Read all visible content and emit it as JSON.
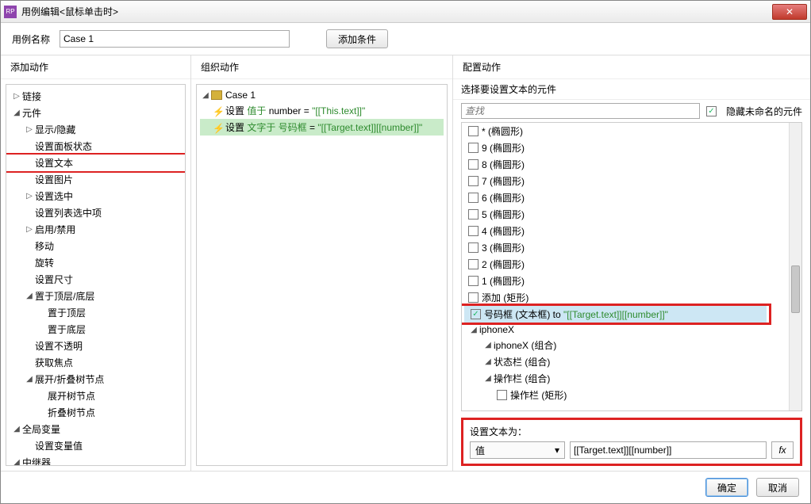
{
  "titlebar": {
    "title": "用例编辑<鼠标单击时>",
    "appicon": "RP"
  },
  "topbar": {
    "name_label": "用例名称",
    "name_value": "Case 1",
    "add_condition": "添加条件"
  },
  "columns": {
    "add_action": "添加动作",
    "org_action": "组织动作",
    "cfg_action": "配置动作"
  },
  "actions_tree": [
    {
      "level": 0,
      "caret": "▷",
      "label": "链接"
    },
    {
      "level": 0,
      "caret": "◢",
      "label": "元件"
    },
    {
      "level": 1,
      "caret": "▷",
      "label": "显示/隐藏"
    },
    {
      "level": 1,
      "caret": "",
      "label": "设置面板状态"
    },
    {
      "level": 1,
      "caret": "",
      "label": "设置文本",
      "red": true
    },
    {
      "level": 1,
      "caret": "",
      "label": "设置图片"
    },
    {
      "level": 1,
      "caret": "▷",
      "label": "设置选中"
    },
    {
      "level": 1,
      "caret": "",
      "label": "设置列表选中项"
    },
    {
      "level": 1,
      "caret": "▷",
      "label": "启用/禁用"
    },
    {
      "level": 1,
      "caret": "",
      "label": "移动"
    },
    {
      "level": 1,
      "caret": "",
      "label": "旋转"
    },
    {
      "level": 1,
      "caret": "",
      "label": "设置尺寸"
    },
    {
      "level": 1,
      "caret": "◢",
      "label": "置于顶层/底层"
    },
    {
      "level": 2,
      "caret": "",
      "label": "置于顶层"
    },
    {
      "level": 2,
      "caret": "",
      "label": "置于底层"
    },
    {
      "level": 1,
      "caret": "",
      "label": "设置不透明"
    },
    {
      "level": 1,
      "caret": "",
      "label": "获取焦点"
    },
    {
      "level": 1,
      "caret": "◢",
      "label": "展开/折叠树节点"
    },
    {
      "level": 2,
      "caret": "",
      "label": "展开树节点"
    },
    {
      "level": 2,
      "caret": "",
      "label": "折叠树节点"
    },
    {
      "level": 0,
      "caret": "◢",
      "label": "全局变量"
    },
    {
      "level": 1,
      "caret": "",
      "label": "设置变量值"
    },
    {
      "level": 0,
      "caret": "◢",
      "label": "中继器"
    }
  ],
  "case": {
    "name": "Case 1",
    "rows": [
      {
        "prefix": "设置 ",
        "green": "值于",
        "mid": " number = ",
        "val": "\"[[This.text]]\""
      },
      {
        "prefix": "设置 ",
        "green": "文字于 号码框",
        "mid": " = ",
        "val": "\"[[Target.text]][[number]]\"",
        "sel": true
      }
    ]
  },
  "config": {
    "subheader": "选择要设置文本的元件",
    "search_placeholder": "查找",
    "hide_unnamed": "隐藏未命名的元件",
    "widgets": [
      {
        "level": 0,
        "caret": "",
        "cb": false,
        "label": "* (椭圆形)"
      },
      {
        "level": 0,
        "caret": "",
        "cb": false,
        "label": "9 (椭圆形)"
      },
      {
        "level": 0,
        "caret": "",
        "cb": false,
        "label": "8 (椭圆形)"
      },
      {
        "level": 0,
        "caret": "",
        "cb": false,
        "label": "7 (椭圆形)"
      },
      {
        "level": 0,
        "caret": "",
        "cb": false,
        "label": "6 (椭圆形)"
      },
      {
        "level": 0,
        "caret": "",
        "cb": false,
        "label": "5 (椭圆形)"
      },
      {
        "level": 0,
        "caret": "",
        "cb": false,
        "label": "4 (椭圆形)"
      },
      {
        "level": 0,
        "caret": "",
        "cb": false,
        "label": "3 (椭圆形)"
      },
      {
        "level": 0,
        "caret": "",
        "cb": false,
        "label": "2 (椭圆形)"
      },
      {
        "level": 0,
        "caret": "",
        "cb": false,
        "label": "1 (椭圆形)"
      },
      {
        "level": 0,
        "caret": "",
        "cb": false,
        "label": "添加 (矩形)"
      },
      {
        "level": 0,
        "caret": "",
        "cb": true,
        "label": "号码框 (文本框) to ",
        "green": "\"[[Target.text]][[number]]\"",
        "sel": true,
        "red": true
      },
      {
        "level": 0,
        "caret": "◢",
        "cb": null,
        "label": "iphoneX"
      },
      {
        "level": 1,
        "caret": "◢",
        "cb": null,
        "label": "iphoneX (组合)"
      },
      {
        "level": 1,
        "caret": "◢",
        "cb": null,
        "label": "状态栏 (组合)"
      },
      {
        "level": 1,
        "caret": "◢",
        "cb": null,
        "label": "操作栏 (组合)"
      },
      {
        "level": 2,
        "caret": "",
        "cb": false,
        "label": "操作栏 (矩形)"
      }
    ],
    "settext_label": "设置文本为：",
    "dropdown_value": "值",
    "text_value": "[[Target.text]][[number]]",
    "fx": "fx"
  },
  "footer": {
    "ok": "确定",
    "cancel": "取消"
  }
}
